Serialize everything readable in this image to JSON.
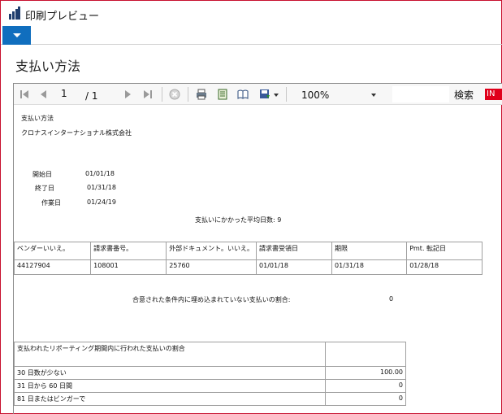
{
  "window": {
    "title": "印刷プレビュー"
  },
  "page": {
    "title": "支払い方法"
  },
  "toolbar": {
    "page_number": "1",
    "page_total": "/ 1",
    "zoom": "100%",
    "search_label": "検索",
    "language_badge": "IN"
  },
  "report": {
    "heading": "支払い方法",
    "company": "クロナスインターナショナル株式会社",
    "fields": [
      {
        "label": "開始日",
        "value": "01/01/18"
      },
      {
        "label": "終了日",
        "value": "01/31/18"
      },
      {
        "label": "作業日",
        "value": "01/24/19"
      }
    ],
    "avg_days_text": "支払いにかかった平均日数: 9",
    "invoice_table": {
      "headers": [
        "ベンダーいいえ。",
        "請求書番号。",
        "外部ドキュメント。いいえ。",
        "請求書受領日",
        "期限",
        "Pmt. 転記日"
      ],
      "row": [
        "44127904",
        "108001",
        "25760",
        "01/01/18",
        "01/31/18",
        "01/28/18"
      ]
    },
    "not_in_terms_label": "合意された条件内に埋め込まれていない支払いの割合:",
    "not_in_terms_value": "0",
    "period_table": {
      "title": "支払われたリポーティング期間内に行われた支払いの割合",
      "rows": [
        {
          "label": "30 日数が少ない",
          "value": "100.00"
        },
        {
          "label": "31 日から 60 日間",
          "value": "0"
        },
        {
          "label": "81 日またはビンガーで",
          "value": "0"
        }
      ]
    }
  }
}
